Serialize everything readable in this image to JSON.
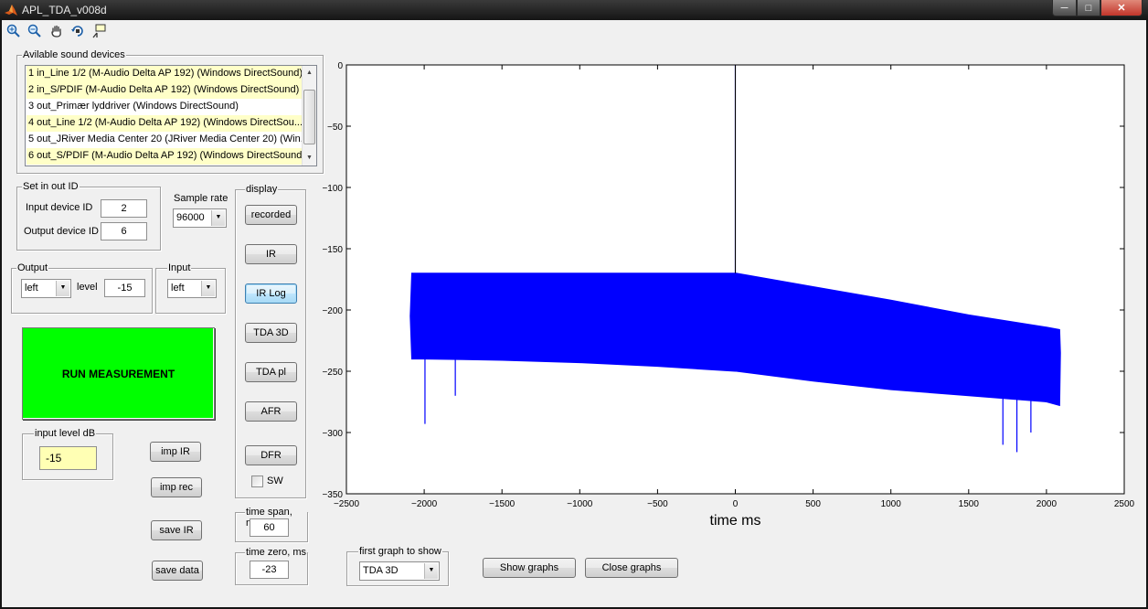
{
  "window": {
    "title": "APL_TDA_v008d"
  },
  "toolbar": {
    "icons": [
      "zoom-in-icon",
      "zoom-out-icon",
      "pan-icon",
      "rotate-3d-icon",
      "data-cursor-icon"
    ]
  },
  "devices": {
    "label": "Avilable sound devices",
    "items": [
      "1 in_Line 1/2 (M-Audio Delta AP 192) (Windows DirectSound)",
      "2 in_S/PDIF (M-Audio Delta AP 192) (Windows DirectSound)",
      "3 out_Primær lyddriver (Windows DirectSound)",
      "4 out_Line 1/2 (M-Audio Delta AP 192) (Windows DirectSou...",
      "5 out_JRiver Media Center 20 (JRiver Media Center 20) (Win...",
      "6 out_S/PDIF (M-Audio Delta AP 192) (Windows DirectSound)"
    ],
    "selected": [
      1,
      3,
      5
    ]
  },
  "setio": {
    "label": "Set in out ID",
    "input_label": "Input device ID",
    "input_value": "2",
    "output_label": "Output device ID",
    "output_value": "6"
  },
  "sample_rate": {
    "label": "Sample rate",
    "value": "96000"
  },
  "output": {
    "label": "Output",
    "channel": "left",
    "level_label": "level",
    "level_value": "-15"
  },
  "input": {
    "label": "Input",
    "channel": "left"
  },
  "run_label": "RUN MEASUREMENT",
  "input_level": {
    "label": "input level dB",
    "value": "-15"
  },
  "file_buttons": {
    "imp_ir": "imp IR",
    "imp_rec": "imp rec",
    "save_ir": "save IR",
    "save_data": "save data"
  },
  "display": {
    "label": "display",
    "buttons": [
      "recorded",
      "IR",
      "IR Log",
      "TDA 3D",
      "TDA pl",
      "AFR",
      "DFR"
    ],
    "focused": "IR Log",
    "sw_label": "SW"
  },
  "time_span": {
    "label": "time span, ms",
    "value": "60"
  },
  "time_zero": {
    "label": "time zero, ms",
    "value": "-23"
  },
  "first_graph": {
    "label": "first graph to show",
    "value": "TDA 3D"
  },
  "show_graphs": "Show graphs",
  "close_graphs": "Close graphs",
  "chart_data": {
    "type": "line",
    "title": "",
    "xlabel": "time  ms",
    "ylabel": "",
    "xlim": [
      -2500,
      2500
    ],
    "ylim": [
      -350,
      0
    ],
    "xticks": [
      -2500,
      -2000,
      -1500,
      -1000,
      -500,
      0,
      500,
      1000,
      1500,
      2000,
      2500
    ],
    "yticks": [
      0,
      -50,
      -100,
      -150,
      -200,
      -250,
      -300,
      -350
    ],
    "grid": false,
    "color": "#0000ff",
    "series": [
      {
        "x": [
          -2090,
          -2080,
          -2000,
          -1500,
          -1000,
          -500,
          0,
          5,
          6,
          500,
          1000,
          1500,
          2000,
          2085,
          2090
        ],
        "upper": [
          -205,
          -170,
          -170,
          -170,
          -170,
          -170,
          -170,
          -170,
          -170,
          -181,
          -192,
          -204,
          -214,
          -216,
          -235
        ],
        "lower": [
          -205,
          -240,
          -240,
          -241,
          -243,
          -246,
          -250,
          -250,
          -250,
          -258,
          -265,
          -270,
          -275,
          -278,
          -235
        ]
      }
    ],
    "spikes": [
      {
        "x": 0,
        "y": 0
      },
      {
        "x": -1995,
        "y": -293
      },
      {
        "x": -1800,
        "y": -270
      },
      {
        "x": 1720,
        "y": -310
      },
      {
        "x": 1810,
        "y": -316
      },
      {
        "x": 1900,
        "y": -300
      }
    ]
  }
}
